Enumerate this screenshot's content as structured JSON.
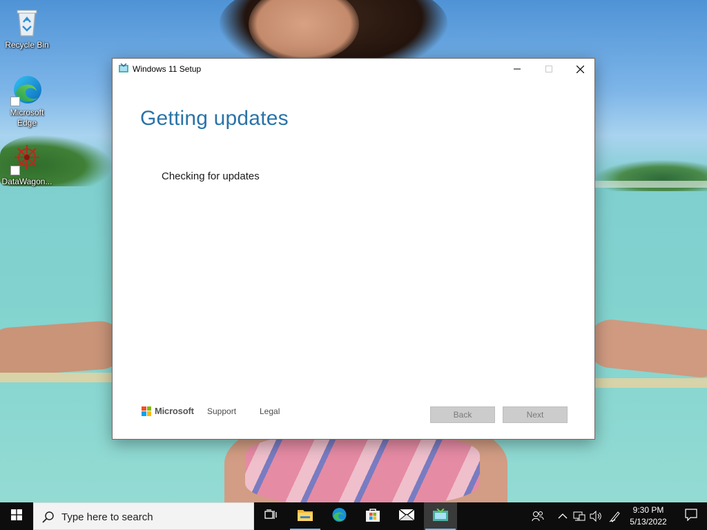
{
  "desktop": {
    "icons": [
      {
        "label": "Recycle Bin",
        "icon": "recycle-bin-icon"
      },
      {
        "label": "Microsoft Edge",
        "icon": "edge-icon"
      },
      {
        "label": "DataWagon...",
        "icon": "datawagon-icon"
      }
    ]
  },
  "window": {
    "title": "Windows 11 Setup",
    "heading": "Getting updates",
    "status": "Checking for updates",
    "footer": {
      "brand": "Microsoft",
      "support_label": "Support",
      "legal_label": "Legal"
    },
    "buttons": {
      "back_label": "Back",
      "next_label": "Next"
    },
    "accent_color": "#2a73a8"
  },
  "taskbar": {
    "search_placeholder": "Type here to search",
    "apps": [
      {
        "name": "task-view",
        "icon": "task-view-icon"
      },
      {
        "name": "file-explorer",
        "icon": "folder-icon"
      },
      {
        "name": "edge",
        "icon": "edge-icon"
      },
      {
        "name": "microsoft-store",
        "icon": "store-icon"
      },
      {
        "name": "mail",
        "icon": "mail-icon"
      },
      {
        "name": "windows-11-setup",
        "icon": "setup-icon"
      }
    ],
    "clock": {
      "time": "9:30 PM",
      "date": "5/13/2022"
    }
  }
}
